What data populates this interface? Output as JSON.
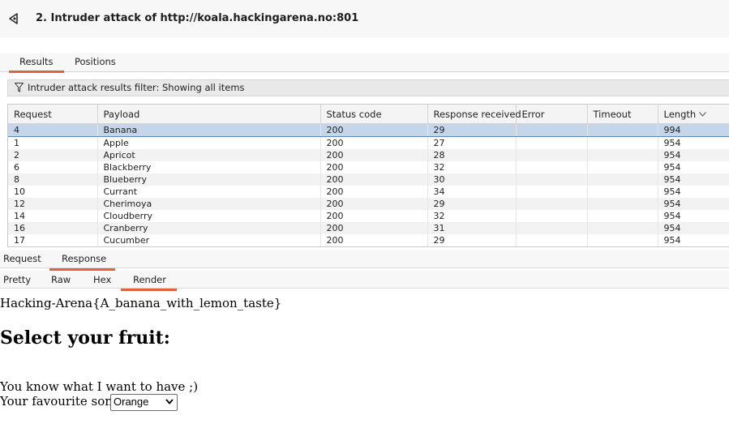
{
  "window": {
    "title": "2. Intruder attack of http://koala.hackingarena.no:801"
  },
  "tabs": {
    "results": "Results",
    "positions": "Positions"
  },
  "filter": {
    "text": "Intruder attack results filter: Showing all items"
  },
  "table": {
    "columns": [
      "Request",
      "Payload",
      "Status code",
      "Response received",
      "Error",
      "Timeout",
      "Length"
    ],
    "rows": [
      [
        "4",
        "Banana",
        "200",
        "29",
        "",
        "",
        "994"
      ],
      [
        "1",
        "Apple",
        "200",
        "27",
        "",
        "",
        "954"
      ],
      [
        "2",
        "Apricot",
        "200",
        "28",
        "",
        "",
        "954"
      ],
      [
        "6",
        "Blackberry",
        "200",
        "32",
        "",
        "",
        "954"
      ],
      [
        "8",
        "Blueberry",
        "200",
        "30",
        "",
        "",
        "954"
      ],
      [
        "10",
        "Currant",
        "200",
        "34",
        "",
        "",
        "954"
      ],
      [
        "12",
        "Cherimoya",
        "200",
        "29",
        "",
        "",
        "954"
      ],
      [
        "14",
        "Cloudberry",
        "200",
        "32",
        "",
        "",
        "954"
      ],
      [
        "16",
        "Cranberry",
        "200",
        "31",
        "",
        "",
        "954"
      ],
      [
        "17",
        "Cucumber",
        "200",
        "29",
        "",
        "",
        "954"
      ]
    ]
  },
  "detail_tabs": {
    "request": "Request",
    "response": "Response"
  },
  "view_tabs": {
    "pretty": "Pretty",
    "raw": "Raw",
    "hex": "Hex",
    "render": "Render"
  },
  "render": {
    "flag": "Hacking-Arena{A_banana_with_lemon_taste}",
    "heading": "Select your fruit:",
    "line1": "You know what I want to have ;)",
    "line2_label": "Your favourite song:",
    "song_selected": "Orange"
  },
  "colors": {
    "accent": "#e2623b",
    "selected_row": "#c6d6ea"
  }
}
